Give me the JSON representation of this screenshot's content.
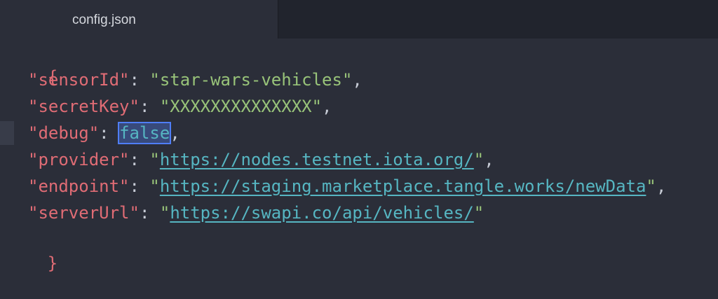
{
  "tab": {
    "title": "config.json"
  },
  "code": {
    "open_brace": "{",
    "close_brace": "}",
    "sensorId": {
      "key": "\"sensorId\"",
      "value": "\"star-wars-vehicles\""
    },
    "secretKey": {
      "key": "\"secretKey\"",
      "value": "\"XXXXXXXXXXXXXX\""
    },
    "debug": {
      "key": "\"debug\"",
      "value": "false"
    },
    "provider": {
      "key": "\"provider\"",
      "value": "https://nodes.testnet.iota.org/"
    },
    "endpoint": {
      "key": "\"endpoint\"",
      "value": "https://staging.marketplace.tangle.works/newData"
    },
    "serverUrl": {
      "key": "\"serverUrl\"",
      "value": "https://swapi.co/api/vehicles/"
    }
  },
  "colors": {
    "background": "#2b2e39",
    "key": "#e06c75",
    "string": "#98c379",
    "link": "#56b6c2",
    "selection_border": "#4f7ef7"
  }
}
